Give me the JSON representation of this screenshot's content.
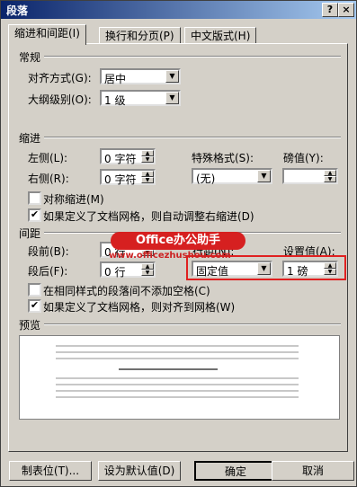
{
  "window": {
    "title": "段落",
    "help_icon": "?",
    "close_icon": "×"
  },
  "tabs": [
    {
      "label": "缩进和间距(I)"
    },
    {
      "label": "换行和分页(P)"
    },
    {
      "label": "中文版式(H)"
    }
  ],
  "general": {
    "section_title": "常规",
    "alignment_label": "对齐方式(G):",
    "alignment_value": "居中",
    "outline_label": "大纲级别(O):",
    "outline_value": "1 级"
  },
  "indent": {
    "section_title": "缩进",
    "left_label": "左侧(L):",
    "left_value": "0 字符",
    "right_label": "右侧(R):",
    "right_value": "0 字符",
    "special_label": "特殊格式(S):",
    "special_value": "(无)",
    "by_label": "磅值(Y):",
    "by_value": "",
    "mirror_label": "对称缩进(M)",
    "mirror_checked": false,
    "auto_adjust_label": "如果定义了文档网格，则自动调整右缩进(D)",
    "auto_adjust_checked": true
  },
  "spacing": {
    "section_title": "间距",
    "before_label": "段前(B):",
    "before_value": "0 行",
    "after_label": "段后(F):",
    "after_value": "0 行",
    "line_label": "行距(N):",
    "line_value": "固定值",
    "at_label": "设置值(A):",
    "at_value": "1 磅",
    "no_space_label": "在相同样式的段落间不添加空格(C)",
    "no_space_checked": false,
    "snap_grid_label": "如果定义了文档网格，则对齐到网格(W)",
    "snap_grid_checked": true
  },
  "preview": {
    "section_title": "预览"
  },
  "watermark": {
    "brand": "Office办公助手",
    "url": "www.officezhushou.com"
  },
  "buttons": {
    "tabs": "制表位(T)...",
    "default": "设为默认值(D)",
    "ok": "确定",
    "cancel": "取消"
  }
}
